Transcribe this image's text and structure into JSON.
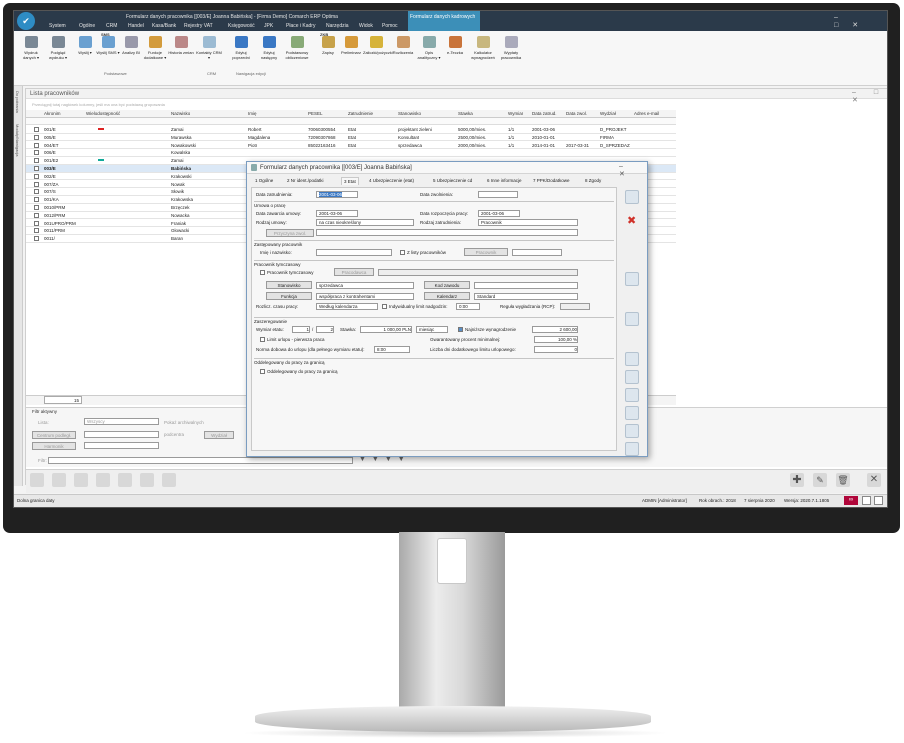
{
  "window": {
    "title": "Formularz danych pracownika [[003/E] Joanna Babińska] - [Firma Demo] Comarch ERP Optima",
    "controls": [
      "–",
      "□",
      "✕"
    ]
  },
  "menu_tabs": [
    "System",
    "Ogólne",
    "CRM",
    "Handel",
    "Kasa/Bank",
    "Rejestry VAT",
    "Księgowość",
    "JPK",
    "Płace i Kadry",
    "Narzędzia",
    "Widok",
    "Pomoc"
  ],
  "context_group": "Formularz danych kadrowych",
  "context_tab": "Formularz danych kadrowych",
  "ribbon": {
    "buttons": [
      "Wydruk danych ▾",
      "Podgląd wydruku ▾",
      "Wyślij ▾",
      "Wyślij SMS ▾",
      "Analizy BI",
      "Funkcje dodatkowe ▾",
      "Historia zmian",
      "Kontakty CRM ▾",
      "Edytuj poprzedni",
      "Edytuj następny",
      "Podstawowy obliczeniowe",
      "Zapisy",
      "Preliminarz",
      "Zaliczki/pożyczki",
      "Rozliczenia",
      "Opis analityczny ▾",
      "e-Teczka",
      "Kalkulator wynagrodzeń",
      "Wypłaty pracownika"
    ],
    "sms_badge": "SMS",
    "zkb_badge": "ZKB",
    "groups": [
      "Podstawowe",
      "CRM",
      "Nawigacja edycji"
    ]
  },
  "side_tabs": [
    "Do pobrania",
    "Moduły/Nawigacja"
  ],
  "list_window": {
    "title": "Lista pracowników",
    "group_hint": "Przeciągnij tutaj nagłówek kolumny, jeśli ma ona być podstawą grupowania",
    "columns": [
      "Akronim",
      "Wielodostępność",
      "Nazwisko",
      "Imię",
      "PESEL",
      "Zatrudnienie",
      "Stanowisko",
      "Stawka",
      "Wymiar",
      "Data zatrud.",
      "Data zwol.",
      "Wydział",
      "Adres e-mail"
    ],
    "rows": [
      {
        "akronim": "001/E",
        "nazwisko": "Zamai",
        "imie": "Robert",
        "pesel": "70060300554",
        "zatr": "Etat",
        "stan": "projektant zieleni",
        "stawka": "5000,00/mies.",
        "wymiar": "1/1",
        "dzatr": "2001-03-06",
        "dzwol": "",
        "wydzial": "D_PROJEKT"
      },
      {
        "akronim": "005/E",
        "nazwisko": "Murawska",
        "imie": "Magdalena",
        "pesel": "72090307868",
        "zatr": "Etat",
        "stan": "Konsultant",
        "stawka": "2500,00/mies.",
        "wymiar": "1/1",
        "dzatr": "2010-01-01",
        "dzwol": "",
        "wydzial": "FIRMA"
      },
      {
        "akronim": "004/ET",
        "nazwisko": "Nowakowski",
        "imie": "Piotr",
        "pesel": "85022163416",
        "zatr": "Etat",
        "stan": "sprzedawca",
        "stawka": "2000,00/mies.",
        "wymiar": "1/1",
        "dzatr": "2014-01-01",
        "dzwol": "2017-03-31",
        "wydzial": "D_SPRZEDAZ"
      },
      {
        "akronim": "006/E",
        "nazwisko": "Kowalska",
        "imie": "",
        "pesel": "",
        "zatr": "",
        "stan": "",
        "stawka": "",
        "wymiar": "",
        "dzatr": "",
        "dzwol": "",
        "wydzial": ""
      },
      {
        "akronim": "001/E2",
        "nazwisko": "Zamai",
        "imie": "",
        "pesel": "",
        "zatr": "",
        "stan": "",
        "stawka": "",
        "wymiar": "",
        "dzatr": "",
        "dzwol": "",
        "wydzial": ""
      },
      {
        "akronim": "003/E",
        "nazwisko": "Babińska",
        "imie": "",
        "pesel": "",
        "zatr": "",
        "stan": "",
        "stawka": "",
        "wymiar": "",
        "dzatr": "",
        "dzwol": "",
        "wydzial": ""
      },
      {
        "akronim": "002/E",
        "nazwisko": "Krakowski",
        "imie": "",
        "pesel": "",
        "zatr": "",
        "stan": "",
        "stawka": "",
        "wymiar": "",
        "dzatr": "",
        "dzwol": "",
        "wydzial": ""
      },
      {
        "akronim": "007/ZA",
        "nazwisko": "Nowak",
        "imie": "",
        "pesel": "",
        "zatr": "",
        "stan": "",
        "stawka": "",
        "wymiar": "",
        "dzatr": "",
        "dzwol": "",
        "wydzial": ""
      },
      {
        "akronim": "007/S",
        "nazwisko": "Słowik",
        "imie": "",
        "pesel": "",
        "zatr": "",
        "stan": "",
        "stawka": "",
        "wymiar": "",
        "dzatr": "",
        "dzwol": "",
        "wydzial": ""
      },
      {
        "akronim": "001/KA",
        "nazwisko": "Krakowska",
        "imie": "",
        "pesel": "",
        "zatr": "",
        "stan": "",
        "stawka": "",
        "wymiar": "",
        "dzatr": "",
        "dzwol": "",
        "wydzial": ""
      },
      {
        "akronim": "0010/PRM",
        "nazwisko": "Brzęczek",
        "imie": "",
        "pesel": "",
        "zatr": "",
        "stan": "",
        "stawka": "",
        "wymiar": "",
        "dzatr": "",
        "dzwol": "",
        "wydzial": ""
      },
      {
        "akronim": "0012/PRM",
        "nazwisko": "Nowacka",
        "imie": "",
        "pesel": "",
        "zatr": "",
        "stan": "",
        "stawka": "",
        "wymiar": "",
        "dzatr": "",
        "dzwol": "",
        "wydzial": ""
      },
      {
        "akronim": "001UPRO/PRM",
        "nazwisko": "Franiak",
        "imie": "",
        "pesel": "",
        "zatr": "",
        "stan": "",
        "stawka": "",
        "wymiar": "",
        "dzatr": "",
        "dzwol": "",
        "wydzial": ""
      },
      {
        "akronim": "0011/PRM",
        "nazwisko": "Głowacki",
        "imie": "",
        "pesel": "",
        "zatr": "",
        "stan": "",
        "stawka": "",
        "wymiar": "",
        "dzatr": "",
        "dzwol": "",
        "wydzial": ""
      },
      {
        "akronim": "0011/",
        "nazwisko": "Baran",
        "imie": "",
        "pesel": "",
        "zatr": "",
        "stan": "",
        "stawka": "",
        "wymiar": "",
        "dzatr": "",
        "dzwol": "",
        "wydzial": ""
      }
    ],
    "count": "15",
    "filter": {
      "title": "Filtr aktywny",
      "lista_label": "Lista:",
      "lista_value": "Wszyscy",
      "centrum_label": "Centrum podległ.",
      "harmonik_label": "Harmonik",
      "pokaz_archiwalnych": "Pokaż archiwalnych",
      "podcentra": "podcentra",
      "wydzial": "Wydział",
      "filtr_label": "Filtr:"
    }
  },
  "dialog": {
    "title": "Formularz danych pracownika [[003/E] Joanna Babińska]",
    "tabs": [
      "1 Ogólne",
      "2 Nr ident./podatki",
      "3 Etat",
      "4 Ubezpieczenie (etat)",
      "5 Ubezpieczenie cd",
      "6 Inne informacje",
      "7 PPK/Dodatkowe",
      "8 Zgody"
    ],
    "data_zatrudnienia_label": "Data zatrudnienia:",
    "data_zatrudnienia": "2001-03-06",
    "data_zwolnienia_label": "Data zwolnienia:",
    "umowa_section": "Umowa o pracę",
    "data_zawarcia_label": "Data zawarcia umowy:",
    "data_zawarcia": "2001-03-06",
    "data_rozpoczecia_label": "Data rozpoczęcia pracy:",
    "data_rozpoczecia": "2001-03-06",
    "rodzaj_umowy_label": "Rodzaj umowy:",
    "rodzaj_umowy": "na czas nieokreślony",
    "rodzaj_zatr_label": "Rodzaj zatrudnienia:",
    "rodzaj_zatr": "Pracownik",
    "przyczyna_zwol": "Przyczyna zwol.",
    "zastepowany_section": "Zastępowany pracownik",
    "imie_nazwisko_label": "Imię i nazwisko:",
    "z_listy_label": "Z listy pracowników",
    "pracownik_btn": "Pracownik",
    "pracownik_tymcz_section": "Pracownik tymczasowy",
    "pracownik_tymcz_chk": "Pracownik tymczasowy",
    "pracodawca_btn": "Pracodawca",
    "stanowisko_btn": "Stanowisko",
    "stanowisko": "sprzedawca",
    "kod_zawodu_btn": "Kod zawodu",
    "funkcja_btn": "Funkcja",
    "funkcja": "współpraca z kontrahentami",
    "kalendarz_btn": "Kalendarz",
    "kalendarz": "Standard",
    "rozlicz_label": "Rozlicz. czasu pracy:",
    "rozlicz": "Według kalendarza",
    "indywidualny_label": "Indywidualny limit nadgodzin:",
    "indywidualny": "0:00",
    "regula_label": "Reguła wygładzania (RCP):",
    "zaszeregowanie_section": "Zaszeregowanie",
    "wymiar_label": "Wymiar etatu:",
    "wymiar_a": "1",
    "wymiar_b": "2",
    "stawka_label": "Stawka:",
    "stawka": "1 000,00 PLN",
    "okres": "miesiąc",
    "najnizsze_label": "Najniższe wynagrodzenie",
    "najnizsze": "2 600,00",
    "limit_urlopu_label": "Limit urlopu - pierwsza praca",
    "gwarantowany_label": "Gwarantowany procent minimalnej:",
    "gwarantowany": "100,00 %",
    "norma_label": "Norma dobowa do urlopu (dla pełnego wymiaru etatu):",
    "norma": "8:00",
    "liczba_dni_label": "Liczba dni dodatkowego limitu urlopowego:",
    "liczba_dni": "0",
    "oddelegowany_section": "Oddelegowany do pracy za granicą",
    "oddelegowany_chk": "Oddelegowany do pracy za granicą"
  },
  "status_bar": {
    "left": "Dolna granica daty",
    "user": "ADMIN [Administrator]",
    "rok": "Rok obrach.: 2018",
    "date": "7 sierpnia 2020",
    "version": "Wersja: 2020.7.1.1805"
  }
}
